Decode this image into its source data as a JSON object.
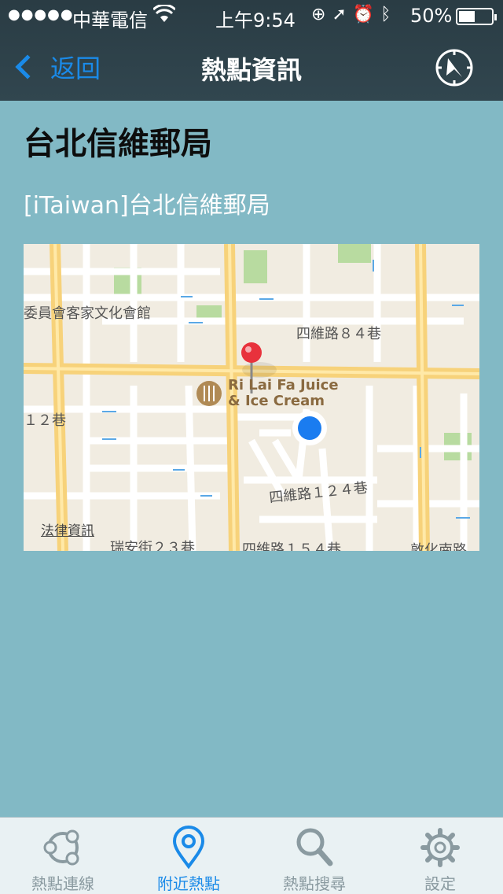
{
  "status_bar": {
    "signal": "●●●●●",
    "carrier": "中華電信",
    "time": "上午9:54",
    "battery_percent": "50%",
    "battery_level": 0.5
  },
  "nav": {
    "back_label": "返回",
    "title": "熱點資訊"
  },
  "hotspot": {
    "name": "台北信維郵局",
    "ssid_label": "[iTaiwan]台北信維郵局"
  },
  "map": {
    "labels": {
      "hakka": "委員會客家文化會館",
      "lane84": "四維路８４巷",
      "lane12": "１２巷",
      "lane124": "四維路１２４巷",
      "ruian": "瑞安街２３巷",
      "lane154": "四維路１５４巷",
      "dunhua": "敦化南路"
    },
    "poi_name_line1": "Ri Lai Fa Juice",
    "poi_name_line2": "& Ice Cream",
    "legal_link": "法律資訊"
  },
  "tabs": [
    {
      "label": "熱點連線",
      "icon": "connection-icon",
      "active": false
    },
    {
      "label": "附近熱點",
      "icon": "location-pin-icon",
      "active": true
    },
    {
      "label": "熱點搜尋",
      "icon": "search-icon",
      "active": false
    },
    {
      "label": "設定",
      "icon": "gear-icon",
      "active": false
    }
  ],
  "colors": {
    "accent": "#1a8ae8",
    "background": "#82b9c5",
    "nav_bar": "#2a3c44",
    "tab_bar": "#e9f1f3"
  }
}
